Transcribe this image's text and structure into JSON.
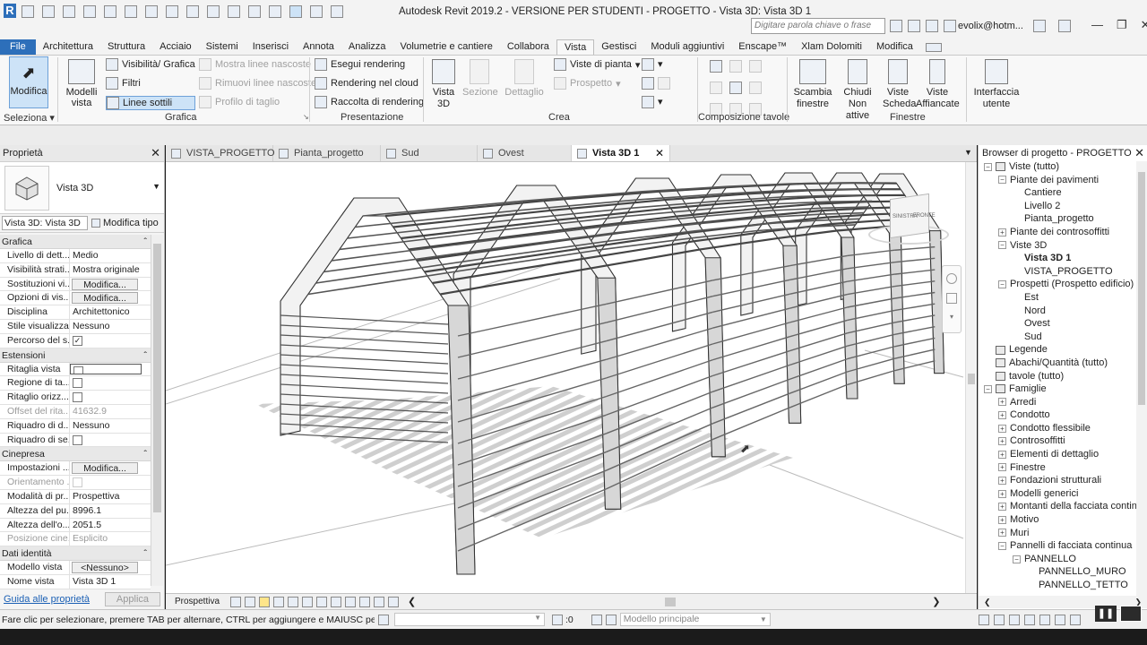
{
  "title": {
    "app_text": "Autodesk Revit 2019.2 - VERSIONE PER STUDENTI - PROGETTO - Vista 3D: Vista 3D 1",
    "search_placeholder": "Digitare parola chiave o frase",
    "user": "evolix@hotm..."
  },
  "ribbon_tabs": [
    "File",
    "Architettura",
    "Struttura",
    "Acciaio",
    "Sistemi",
    "Inserisci",
    "Annota",
    "Analizza",
    "Volumetrie e cantiere",
    "Collabora",
    "Vista",
    "Gestisci",
    "Moduli aggiuntivi",
    "Enscape™",
    "Xlam Dolomiti",
    "Modifica"
  ],
  "active_tab": "Vista",
  "ribbon": {
    "modifica": "Modifica",
    "seleziona": "Seleziona",
    "modelli_vista": "Modelli vista",
    "visibilita": "Visibilità/ Grafica",
    "filtri": "Filtri",
    "linee_sottili": "Linee sottili",
    "mostra_linee": "Mostra linee nascoste",
    "rimuovi_linee": "Rimuovi linee nascoste",
    "profilo": "Profilo di taglio",
    "grafica": "Grafica",
    "esegui_rendering": "Esegui rendering",
    "rendering_cloud": "Rendering  nel cloud",
    "raccolta": "Raccolta  di rendering",
    "presentazione": "Presentazione",
    "vista3d": "Vista 3D",
    "sezione": "Sezione",
    "dettaglio": "Dettaglio",
    "viste_pianta": "Viste di pianta",
    "prospetto": "Prospetto",
    "crea": "Crea",
    "composizione": "Composizione tavole",
    "scambia": "Scambia finestre",
    "chiudi": "Chiudi Non attive",
    "scheda": "Viste Scheda",
    "affiancate": "Viste Affiancate",
    "finestre": "Finestre",
    "interfaccia": "Interfaccia utente"
  },
  "properties": {
    "header": "Proprietà",
    "type_name": "Vista 3D",
    "instance": "Vista 3D: Vista 3D",
    "modifica_tipo": "Modifica tipo",
    "sections": [
      {
        "name": "Grafica",
        "rows": [
          {
            "k": "Livello di dett...",
            "v": "Medio",
            "kind": "text"
          },
          {
            "k": "Visibilità strati...",
            "v": "Mostra originale",
            "kind": "text"
          },
          {
            "k": "Sostituzioni vi...",
            "v": "Modifica...",
            "kind": "button"
          },
          {
            "k": "Opzioni di vis...",
            "v": "Modifica...",
            "kind": "button"
          },
          {
            "k": "Disciplina",
            "v": "Architettonico",
            "kind": "text"
          },
          {
            "k": "Stile visualizza...",
            "v": "Nessuno",
            "kind": "text"
          },
          {
            "k": "Percorso del s...",
            "v": "",
            "kind": "check_on"
          }
        ]
      },
      {
        "name": "Estensioni",
        "rows": [
          {
            "k": "Ritaglia vista",
            "v": "",
            "kind": "check_box"
          },
          {
            "k": "Regione di ta...",
            "v": "",
            "kind": "check"
          },
          {
            "k": "Ritaglio orizz...",
            "v": "",
            "kind": "check"
          },
          {
            "k": "Offset del rita...",
            "v": "41632.9",
            "kind": "grey"
          },
          {
            "k": "Riquadro di d...",
            "v": "Nessuno",
            "kind": "text"
          },
          {
            "k": "Riquadro di se...",
            "v": "",
            "kind": "check"
          }
        ]
      },
      {
        "name": "Cinepresa",
        "rows": [
          {
            "k": "Impostazioni ...",
            "v": "Modifica...",
            "kind": "button"
          },
          {
            "k": "Orientamento ...",
            "v": "",
            "kind": "grey_check"
          },
          {
            "k": "Modalità di pr...",
            "v": "Prospettiva",
            "kind": "text"
          },
          {
            "k": "Altezza del pu...",
            "v": "8996.1",
            "kind": "text"
          },
          {
            "k": "Altezza dell'o...",
            "v": "2051.5",
            "kind": "text"
          },
          {
            "k": "Posizione cine...",
            "v": "Esplicito",
            "kind": "grey"
          }
        ]
      },
      {
        "name": "Dati identità",
        "rows": [
          {
            "k": "Modello vista",
            "v": "<Nessuno>",
            "kind": "button"
          },
          {
            "k": "Nome vista",
            "v": "Vista 3D 1",
            "kind": "text"
          }
        ]
      }
    ],
    "guide": "Guida alle proprietà",
    "apply": "Applica"
  },
  "view_tabs": [
    "VISTA_PROGETTO",
    "Pianta_progetto",
    "Sud",
    "Ovest",
    "Vista 3D 1"
  ],
  "view_bar": {
    "mode": "Prospettiva"
  },
  "viewcube": {
    "left": "SINISTRA",
    "front": "FRONTE"
  },
  "browser": {
    "header": "Browser di progetto - PROGETTO",
    "items": [
      {
        "t": "Viste (tutto)",
        "lvl": 0,
        "ex": "-",
        "icon": true
      },
      {
        "t": "Piante dei pavimenti",
        "lvl": 1,
        "ex": "-"
      },
      {
        "t": "Cantiere",
        "lvl": 2,
        "ex": ""
      },
      {
        "t": "Livello 2",
        "lvl": 2,
        "ex": ""
      },
      {
        "t": "Pianta_progetto",
        "lvl": 2,
        "ex": ""
      },
      {
        "t": "Piante dei controsoffitti",
        "lvl": 1,
        "ex": "+"
      },
      {
        "t": "Viste 3D",
        "lvl": 1,
        "ex": "-"
      },
      {
        "t": "Vista 3D 1",
        "lvl": 2,
        "ex": "",
        "bold": true
      },
      {
        "t": "VISTA_PROGETTO",
        "lvl": 2,
        "ex": ""
      },
      {
        "t": "Prospetti (Prospetto edificio)",
        "lvl": 1,
        "ex": "-"
      },
      {
        "t": "Est",
        "lvl": 2,
        "ex": ""
      },
      {
        "t": "Nord",
        "lvl": 2,
        "ex": ""
      },
      {
        "t": "Ovest",
        "lvl": 2,
        "ex": ""
      },
      {
        "t": "Sud",
        "lvl": 2,
        "ex": ""
      },
      {
        "t": "Legende",
        "lvl": 0,
        "ex": "",
        "icon": true
      },
      {
        "t": "Abachi/Quantità (tutto)",
        "lvl": 0,
        "ex": "",
        "icon": true
      },
      {
        "t": "tavole (tutto)",
        "lvl": 0,
        "ex": "",
        "icon": true
      },
      {
        "t": "Famiglie",
        "lvl": 0,
        "ex": "-",
        "icon": true
      },
      {
        "t": "Arredi",
        "lvl": 1,
        "ex": "+"
      },
      {
        "t": "Condotto",
        "lvl": 1,
        "ex": "+"
      },
      {
        "t": "Condotto flessibile",
        "lvl": 1,
        "ex": "+"
      },
      {
        "t": "Controsoffitti",
        "lvl": 1,
        "ex": "+"
      },
      {
        "t": "Elementi di dettaglio",
        "lvl": 1,
        "ex": "+"
      },
      {
        "t": "Finestre",
        "lvl": 1,
        "ex": "+"
      },
      {
        "t": "Fondazioni strutturali",
        "lvl": 1,
        "ex": "+"
      },
      {
        "t": "Modelli generici",
        "lvl": 1,
        "ex": "+"
      },
      {
        "t": "Montanti della facciata contin",
        "lvl": 1,
        "ex": "+"
      },
      {
        "t": "Motivo",
        "lvl": 1,
        "ex": "+"
      },
      {
        "t": "Muri",
        "lvl": 1,
        "ex": "+"
      },
      {
        "t": "Pannelli di facciata continua",
        "lvl": 1,
        "ex": "-"
      },
      {
        "t": "PANNELLO",
        "lvl": 2,
        "ex": "-"
      },
      {
        "t": "PANNELLO_MURO",
        "lvl": 3,
        "ex": ""
      },
      {
        "t": "PANNELLO_TETTO",
        "lvl": 3,
        "ex": ""
      }
    ]
  },
  "status": {
    "hint": "Fare clic per selezionare, premere TAB per alternare, CTRL per aggiungere e MAIUSC per desel",
    "zero": ":0",
    "model": "Modello principale"
  },
  "colors": {
    "file_tab": "#2d6fba",
    "active_blue": "#cde3f7",
    "status_bg": "#f0f0f0"
  }
}
